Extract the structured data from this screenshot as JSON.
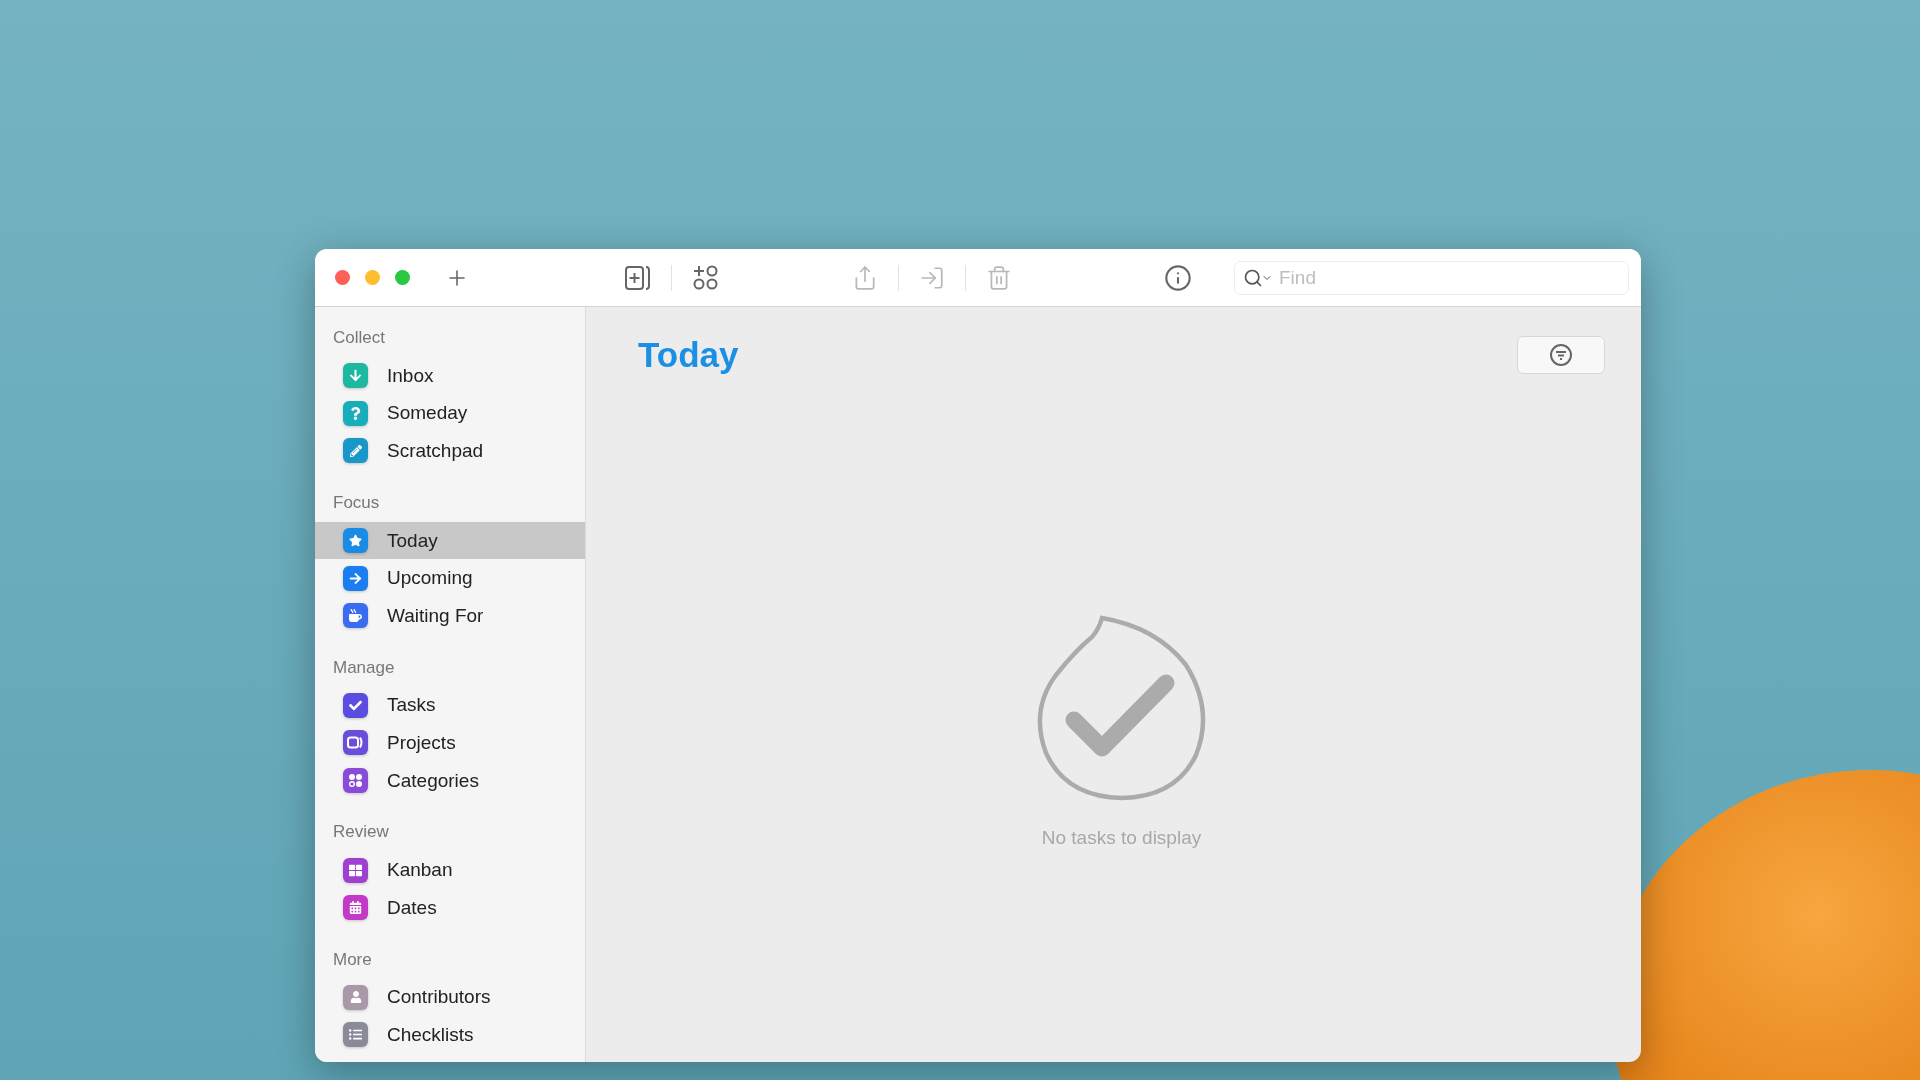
{
  "toolbar": {
    "items": [
      {
        "kind": "new-task",
        "disabled": false
      },
      {
        "kind": "add-to-list",
        "disabled": false
      },
      {
        "kind": "categories",
        "disabled": false
      },
      {
        "kind": "share",
        "disabled": true
      },
      {
        "kind": "move",
        "disabled": true
      },
      {
        "kind": "delete",
        "disabled": true
      },
      {
        "kind": "info",
        "disabled": false
      }
    ],
    "search": {
      "placeholder": "Find"
    }
  },
  "sidebar": {
    "sections": [
      {
        "title": "Collect",
        "items": [
          {
            "label": "Inbox",
            "kind": "inbox",
            "color": "#1db8a0",
            "selected": false
          },
          {
            "label": "Someday",
            "kind": "someday",
            "color": "#18adbb",
            "selected": false
          },
          {
            "label": "Scratchpad",
            "kind": "scratchpad",
            "color": "#1897c8",
            "selected": false
          }
        ]
      },
      {
        "title": "Focus",
        "items": [
          {
            "label": "Today",
            "kind": "today",
            "color": "#1a8ce6",
            "selected": true
          },
          {
            "label": "Upcoming",
            "kind": "upcoming",
            "color": "#1a7ef0",
            "selected": false
          },
          {
            "label": "Waiting For",
            "kind": "waiting",
            "color": "#3a6cf0",
            "selected": false
          }
        ]
      },
      {
        "title": "Manage",
        "items": [
          {
            "label": "Tasks",
            "kind": "tasks",
            "color": "#5a4de0",
            "selected": false
          },
          {
            "label": "Projects",
            "kind": "projects",
            "color": "#6a4dd8",
            "selected": false
          },
          {
            "label": "Categories",
            "kind": "categories",
            "color": "#8a4cd8",
            "selected": false
          }
        ]
      },
      {
        "title": "Review",
        "items": [
          {
            "label": "Kanban",
            "kind": "kanban",
            "color": "#a040d0",
            "selected": false
          },
          {
            "label": "Dates",
            "kind": "dates",
            "color": "#c238c8",
            "selected": false
          }
        ]
      },
      {
        "title": "More",
        "items": [
          {
            "label": "Contributors",
            "kind": "contributors",
            "color": "#a898a8",
            "selected": false
          },
          {
            "label": "Checklists",
            "kind": "checklists",
            "color": "#8a8a98",
            "selected": false
          }
        ]
      }
    ]
  },
  "main": {
    "title": "Today",
    "empty_message": "No tasks to display"
  }
}
